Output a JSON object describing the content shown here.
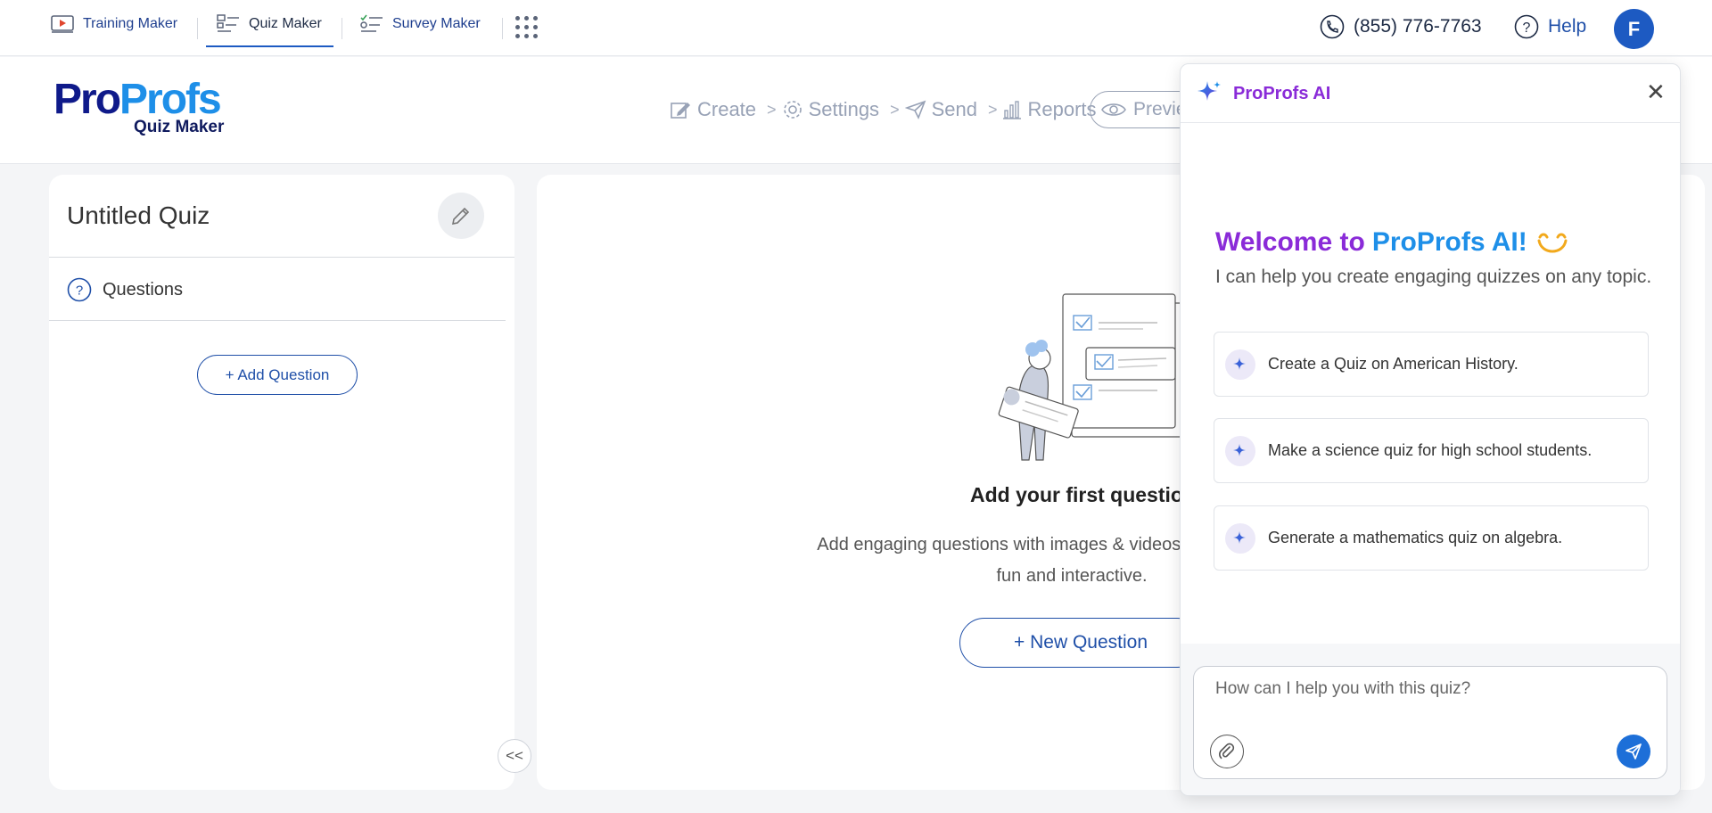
{
  "topbar": {
    "products": [
      {
        "label": "Training Maker",
        "icon": "video-play-icon",
        "active": false
      },
      {
        "label": "Quiz Maker",
        "icon": "quiz-list-icon",
        "active": true
      },
      {
        "label": "Survey Maker",
        "icon": "survey-checklist-icon",
        "active": false
      }
    ],
    "phone": "(855) 776-7763",
    "help_label": "Help",
    "avatar_initial": "F"
  },
  "header": {
    "logo": {
      "part1": "Pro",
      "part2": "Profs",
      "subtitle": "Quiz Maker"
    },
    "steps": [
      "Create",
      "Settings",
      "Send",
      "Reports"
    ],
    "preview_label": "Preview"
  },
  "sidebar": {
    "quiz_title": "Untitled Quiz",
    "questions_label": "Questions",
    "add_question_label": "+ Add Question",
    "collapse_label": "<<"
  },
  "main": {
    "empty_title": "Add your first question",
    "empty_desc": "Add engaging questions with images & videos to make your quiz fun and interactive.",
    "new_question_label": "+ New Question"
  },
  "ai": {
    "title": "ProProfs AI",
    "welcome_part1": "Welcome to",
    "welcome_part2": "ProProfs AI!",
    "intro": "I can help you create engaging quizzes on any topic.",
    "suggestions": [
      "Create a Quiz on American History.",
      "Make a science quiz for high school students.",
      "Generate a mathematics quiz on algebra."
    ],
    "input_placeholder": "How can I help you with this quiz?"
  },
  "colors": {
    "brand_blue": "#1d5ac2",
    "ai_purple": "#8a2bd8",
    "ai_blue": "#1e8fe8",
    "logo_navy": "#0f1a8a"
  }
}
